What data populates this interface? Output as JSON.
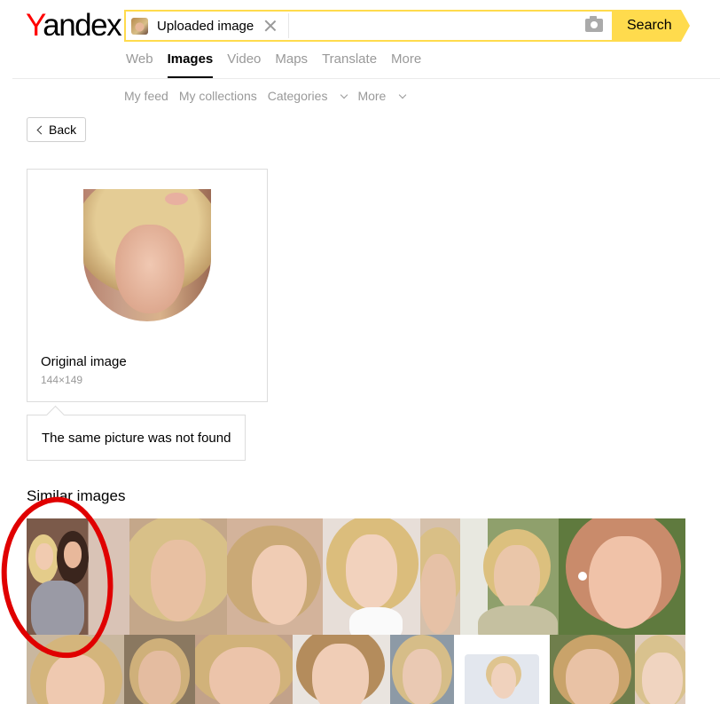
{
  "logo": {
    "first": "Y",
    "rest": "andex"
  },
  "search": {
    "chip_label": "Uploaded image",
    "button_label": "Search"
  },
  "tabs": [
    {
      "label": "Web",
      "active": false
    },
    {
      "label": "Images",
      "active": true
    },
    {
      "label": "Video",
      "active": false
    },
    {
      "label": "Maps",
      "active": false
    },
    {
      "label": "Translate",
      "active": false
    },
    {
      "label": "More",
      "active": false
    }
  ],
  "subnav": {
    "my_feed": "My feed",
    "my_collections": "My collections",
    "categories": "Categories",
    "more": "More"
  },
  "back_label": "Back",
  "original": {
    "title": "Original image",
    "size": "144×149"
  },
  "not_found_text": "The same picture was not found",
  "similar_title": "Similar images",
  "colors": {
    "accent_yellow": "#ffdb4d",
    "logo_red": "#ff0000",
    "annotation_red": "#e00000"
  }
}
